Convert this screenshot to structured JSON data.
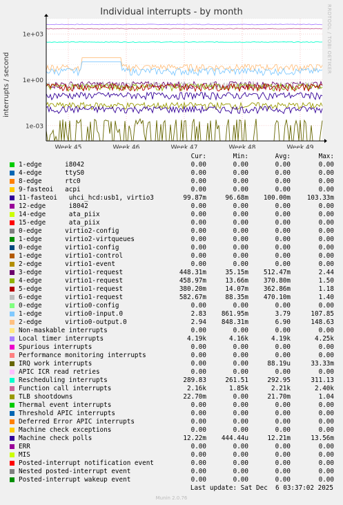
{
  "title": "Individual interrupts - by month",
  "side_label": "RRDTOOL / TOBI OETIKER",
  "y_axis_label": "interrupts / second",
  "y_ticks": [
    "1e+03",
    "1e+00",
    "1e-03"
  ],
  "x_ticks": [
    "Week 45",
    "Week 46",
    "Week 47",
    "Week 48",
    "Week 49"
  ],
  "columns": {
    "cur": "Cur:",
    "min": "Min:",
    "avg": "Avg:",
    "max": "Max:"
  },
  "rows": [
    {
      "name": "1-edge      i8042",
      "color": "#00cc00",
      "cur": "0.00",
      "min": "0.00",
      "avg": "0.00",
      "max": "0.00"
    },
    {
      "name": "4-edge      ttyS0",
      "color": "#0066b3",
      "cur": "0.00",
      "min": "0.00",
      "avg": "0.00",
      "max": "0.00"
    },
    {
      "name": "8-edge      rtc0",
      "color": "#ff8000",
      "cur": "0.00",
      "min": "0.00",
      "avg": "0.00",
      "max": "0.00"
    },
    {
      "name": "9-fasteoi   acpi",
      "color": "#ffcc00",
      "cur": "0.00",
      "min": "0.00",
      "avg": "0.00",
      "max": "0.00"
    },
    {
      "name": "11-fasteoi   uhci_hcd:usb1, virtio3",
      "color": "#330099",
      "cur": "99.87m",
      "min": "96.68m",
      "avg": "100.00m",
      "max": "103.33m"
    },
    {
      "name": "12-edge      i8042",
      "color": "#990099",
      "cur": "0.00",
      "min": "0.00",
      "avg": "0.00",
      "max": "0.00"
    },
    {
      "name": "14-edge      ata_piix",
      "color": "#ccff00",
      "cur": "0.00",
      "min": "0.00",
      "avg": "0.00",
      "max": "0.00"
    },
    {
      "name": "15-edge      ata_piix",
      "color": "#ff0000",
      "cur": "0.00",
      "min": "0.00",
      "avg": "0.00",
      "max": "0.00"
    },
    {
      "name": "0-edge      virtio2-config",
      "color": "#808080",
      "cur": "0.00",
      "min": "0.00",
      "avg": "0.00",
      "max": "0.00"
    },
    {
      "name": "1-edge      virtio2-virtqueues",
      "color": "#008f00",
      "cur": "0.00",
      "min": "0.00",
      "avg": "0.00",
      "max": "0.00"
    },
    {
      "name": "0-edge      virtio1-config",
      "color": "#00487d",
      "cur": "0.00",
      "min": "0.00",
      "avg": "0.00",
      "max": "0.00"
    },
    {
      "name": "1-edge      virtio1-control",
      "color": "#b35a00",
      "cur": "0.00",
      "min": "0.00",
      "avg": "0.00",
      "max": "0.00"
    },
    {
      "name": "2-edge      virtio1-event",
      "color": "#b38f00",
      "cur": "0.00",
      "min": "0.00",
      "avg": "0.00",
      "max": "0.00"
    },
    {
      "name": "3-edge      virtio1-request",
      "color": "#6b006b",
      "cur": "448.31m",
      "min": "35.15m",
      "avg": "512.47m",
      "max": "2.44"
    },
    {
      "name": "4-edge      virtio1-request",
      "color": "#8fb300",
      "cur": "458.97m",
      "min": "13.66m",
      "avg": "370.80m",
      "max": "1.50"
    },
    {
      "name": "5-edge      virtio1-request",
      "color": "#b30000",
      "cur": "380.20m",
      "min": "14.07m",
      "avg": "362.86m",
      "max": "1.18"
    },
    {
      "name": "6-edge      virtio1-request",
      "color": "#bebebe",
      "cur": "582.67m",
      "min": "88.35m",
      "avg": "470.10m",
      "max": "1.40"
    },
    {
      "name": "0-edge      virtio0-config",
      "color": "#80ff80",
      "cur": "0.00",
      "min": "0.00",
      "avg": "0.00",
      "max": "0.00"
    },
    {
      "name": "1-edge      virtio0-input.0",
      "color": "#80c9ff",
      "cur": "2.83",
      "min": "861.95m",
      "avg": "3.79",
      "max": "107.85"
    },
    {
      "name": "2-edge      virtio0-output.0",
      "color": "#ffc080",
      "cur": "2.94",
      "min": "848.31m",
      "avg": "6.90",
      "max": "148.63"
    },
    {
      "name": "Non-maskable interrupts",
      "color": "#ffe680",
      "cur": "0.00",
      "min": "0.00",
      "avg": "0.00",
      "max": "0.00"
    },
    {
      "name": "Local timer interrupts",
      "color": "#aa80ff",
      "cur": "4.19k",
      "min": "4.16k",
      "avg": "4.19k",
      "max": "4.25k"
    },
    {
      "name": "Spurious interrupts",
      "color": "#ee00cc",
      "cur": "0.00",
      "min": "0.00",
      "avg": "0.00",
      "max": "0.00"
    },
    {
      "name": "Performance monitoring interrupts",
      "color": "#ff8080",
      "cur": "0.00",
      "min": "0.00",
      "avg": "0.00",
      "max": "0.00"
    },
    {
      "name": "IRQ work interrupts",
      "color": "#666600",
      "cur": "0.00",
      "min": "0.00",
      "avg": "88.19u",
      "max": "33.33m"
    },
    {
      "name": "APIC ICR read retries",
      "color": "#ffbfff",
      "cur": "0.00",
      "min": "0.00",
      "avg": "0.00",
      "max": "0.00"
    },
    {
      "name": "Rescheduling interrupts",
      "color": "#00ffcc",
      "cur": "289.83",
      "min": "261.51",
      "avg": "292.95",
      "max": "311.13"
    },
    {
      "name": "Function call interrupts",
      "color": "#cc6699",
      "cur": "2.16k",
      "min": "1.85k",
      "avg": "2.21k",
      "max": "2.40k"
    },
    {
      "name": "TLB shootdowns",
      "color": "#999900",
      "cur": "22.70m",
      "min": "0.00",
      "avg": "21.70m",
      "max": "1.04"
    },
    {
      "name": "Thermal event interrupts",
      "color": "#00cc00",
      "cur": "0.00",
      "min": "0.00",
      "avg": "0.00",
      "max": "0.00"
    },
    {
      "name": "Threshold APIC interrupts",
      "color": "#0066b3",
      "cur": "0.00",
      "min": "0.00",
      "avg": "0.00",
      "max": "0.00"
    },
    {
      "name": "Deferred Error APIC interrupts",
      "color": "#ff8000",
      "cur": "0.00",
      "min": "0.00",
      "avg": "0.00",
      "max": "0.00"
    },
    {
      "name": "Machine check exceptions",
      "color": "#ffcc00",
      "cur": "0.00",
      "min": "0.00",
      "avg": "0.00",
      "max": "0.00"
    },
    {
      "name": "Machine check polls",
      "color": "#330099",
      "cur": "12.22m",
      "min": "444.44u",
      "avg": "12.21m",
      "max": "13.56m"
    },
    {
      "name": "ERR",
      "color": "#990099",
      "cur": "0.00",
      "min": "0.00",
      "avg": "0.00",
      "max": "0.00"
    },
    {
      "name": "MIS",
      "color": "#ccff00",
      "cur": "0.00",
      "min": "0.00",
      "avg": "0.00",
      "max": "0.00"
    },
    {
      "name": "Posted-interrupt notification event",
      "color": "#ff0000",
      "cur": "0.00",
      "min": "0.00",
      "avg": "0.00",
      "max": "0.00"
    },
    {
      "name": "Nested posted-interrupt event",
      "color": "#808080",
      "cur": "0.00",
      "min": "0.00",
      "avg": "0.00",
      "max": "0.00"
    },
    {
      "name": "Posted-interrupt wakeup event",
      "color": "#008f00",
      "cur": "0.00",
      "min": "0.00",
      "avg": "0.00",
      "max": "0.00"
    }
  ],
  "last_update": "Last update: Sat Dec  6 03:37:02 2025",
  "footer": "Munin 2.0.76",
  "chart_data": {
    "type": "line",
    "title": "Individual interrupts - by month",
    "ylabel": "interrupts / second",
    "yscale": "log",
    "ylim": [
      0.0001,
      10000
    ],
    "x_categories": [
      "Week 45",
      "Week 46",
      "Week 47",
      "Week 48",
      "Week 49"
    ],
    "series": [
      {
        "name": "Local timer interrupts",
        "color": "#aa80ff",
        "level": 4190
      },
      {
        "name": "Function call interrupts",
        "color": "#cc6699",
        "level": 2210
      },
      {
        "name": "Rescheduling interrupts",
        "color": "#00ffcc",
        "level": 292.95
      },
      {
        "name": "2-edge      virtio0-output.0",
        "color": "#ffc080",
        "level": 6.9
      },
      {
        "name": "1-edge      virtio0-input.0",
        "color": "#80c9ff",
        "level": 3.79
      },
      {
        "name": "3-edge      virtio1-request",
        "color": "#6b006b",
        "level": 0.51
      },
      {
        "name": "6-edge      virtio1-request",
        "color": "#bebebe",
        "level": 0.47
      },
      {
        "name": "4-edge      virtio1-request",
        "color": "#8fb300",
        "level": 0.37
      },
      {
        "name": "5-edge      virtio1-request",
        "color": "#b30000",
        "level": 0.36
      },
      {
        "name": "11-fasteoi   uhci_hcd:usb1, virtio3",
        "color": "#330099",
        "level": 0.1
      },
      {
        "name": "TLB shootdowns",
        "color": "#999900",
        "level": 0.0217
      },
      {
        "name": "Machine check polls",
        "color": "#330099",
        "level": 0.0122
      },
      {
        "name": "IRQ work interrupts",
        "color": "#666600",
        "level": 8.82e-05
      }
    ]
  }
}
